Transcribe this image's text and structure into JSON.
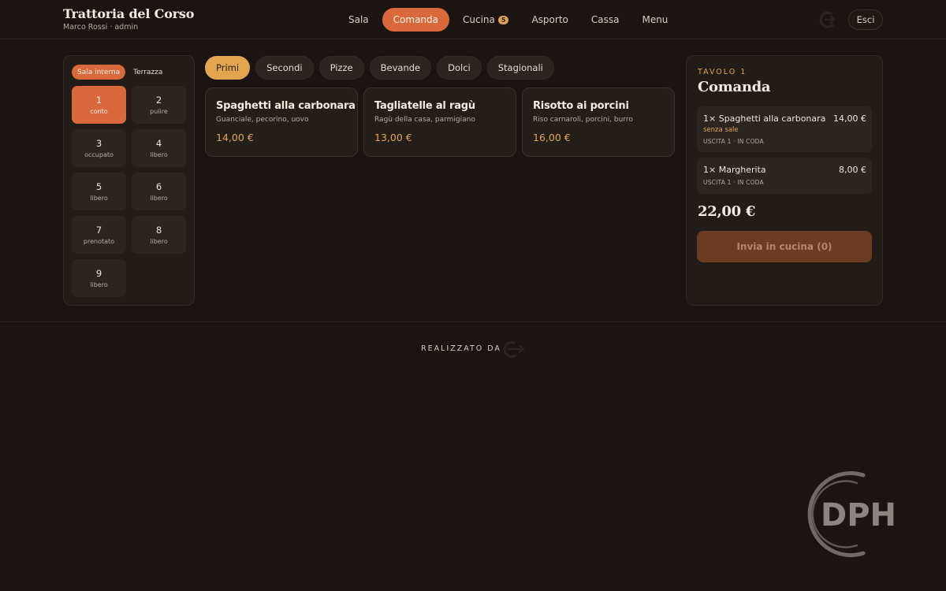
{
  "brand": {
    "title": "Trattoria del Corso",
    "subtitle": "Marco Rossi · admin"
  },
  "nav": {
    "items": [
      {
        "label": "Sala"
      },
      {
        "label": "Comanda",
        "active": true
      },
      {
        "label": "Cucina",
        "badge": "5"
      },
      {
        "label": "Asporto"
      },
      {
        "label": "Cassa"
      },
      {
        "label": "Menu"
      }
    ],
    "logout_label": "Esci"
  },
  "rooms": {
    "tabs": [
      {
        "label": "Sala interna",
        "active": true
      },
      {
        "label": "Terrazza"
      }
    ],
    "tables": [
      {
        "num": "1",
        "status": "conto",
        "active": true
      },
      {
        "num": "2",
        "status": "pulire"
      },
      {
        "num": "3",
        "status": "occupato"
      },
      {
        "num": "4",
        "status": "libero"
      },
      {
        "num": "5",
        "status": "libero"
      },
      {
        "num": "6",
        "status": "libero"
      },
      {
        "num": "7",
        "status": "prenotato"
      },
      {
        "num": "8",
        "status": "libero"
      },
      {
        "num": "9",
        "status": "libero"
      }
    ]
  },
  "categories": [
    {
      "label": "Primi",
      "active": true
    },
    {
      "label": "Secondi"
    },
    {
      "label": "Pizze"
    },
    {
      "label": "Bevande"
    },
    {
      "label": "Dolci"
    },
    {
      "label": "Stagionali"
    }
  ],
  "dishes": [
    {
      "name": "Spaghetti alla carbonara",
      "desc": "Guanciale, pecorino, uovo",
      "price": "14,00 €"
    },
    {
      "name": "Tagliatelle al ragù",
      "desc": "Ragù della casa, parmigiano",
      "price": "13,00 €"
    },
    {
      "name": "Risotto ai porcini",
      "desc": "Riso carnaroli, porcini, burro",
      "price": "16,00 €"
    }
  ],
  "order": {
    "table_label": "TAVOLO 1",
    "title": "Comanda",
    "items": [
      {
        "name": "1× Spaghetti alla carbonara",
        "price": "14,00 €",
        "note": "senza sale",
        "status": "USCITA 1 · IN CODA"
      },
      {
        "name": "1× Margherita",
        "price": "8,00 €",
        "status": "USCITA 1 · IN CODA"
      }
    ],
    "total": "22,00 €",
    "send_label": "Invia in cucina (0)"
  },
  "footer": {
    "credit": "REALIZZATO DA"
  },
  "watermark": {
    "text": "DPH"
  },
  "colors": {
    "accent": "#d9683b",
    "gold": "#e3a54e",
    "background": "#1a1512",
    "panel": "#221c18"
  }
}
